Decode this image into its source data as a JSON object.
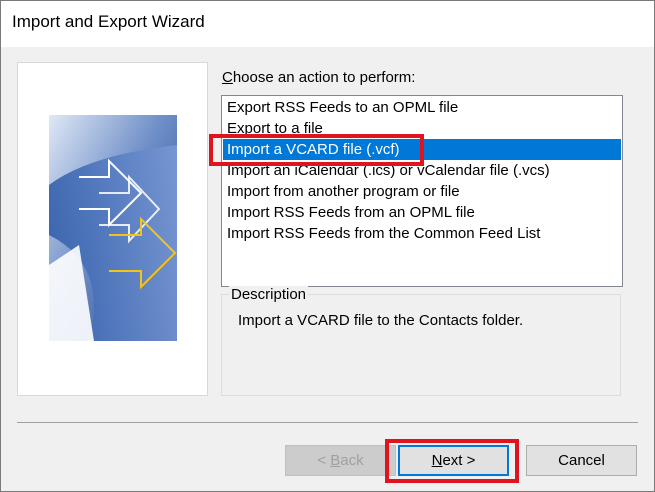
{
  "window": {
    "title": "Import and Export Wizard"
  },
  "wizard": {
    "choose_label_mnemonic": "C",
    "choose_label_rest": "hoose an action to perform:",
    "actions": [
      "Export RSS Feeds to an OPML file",
      "Export to a file",
      "Import a VCARD file (.vcf)",
      "Import an iCalendar (.ics) or vCalendar file (.vcs)",
      "Import from another program or file",
      "Import RSS Feeds from an OPML file",
      "Import RSS Feeds from the Common Feed List"
    ],
    "selected_action": "Import a VCARD file (.vcf)",
    "description_label": "Description",
    "description_text": "Import a VCARD file to the Contacts folder."
  },
  "buttons": {
    "back_prefix": "< ",
    "back_mnemonic": "B",
    "back_rest": "ack",
    "next_mnemonic": "N",
    "next_rest": "ext >",
    "cancel": "Cancel"
  },
  "colors": {
    "selection": "#0078d7",
    "highlight_box": "#e0141e"
  }
}
